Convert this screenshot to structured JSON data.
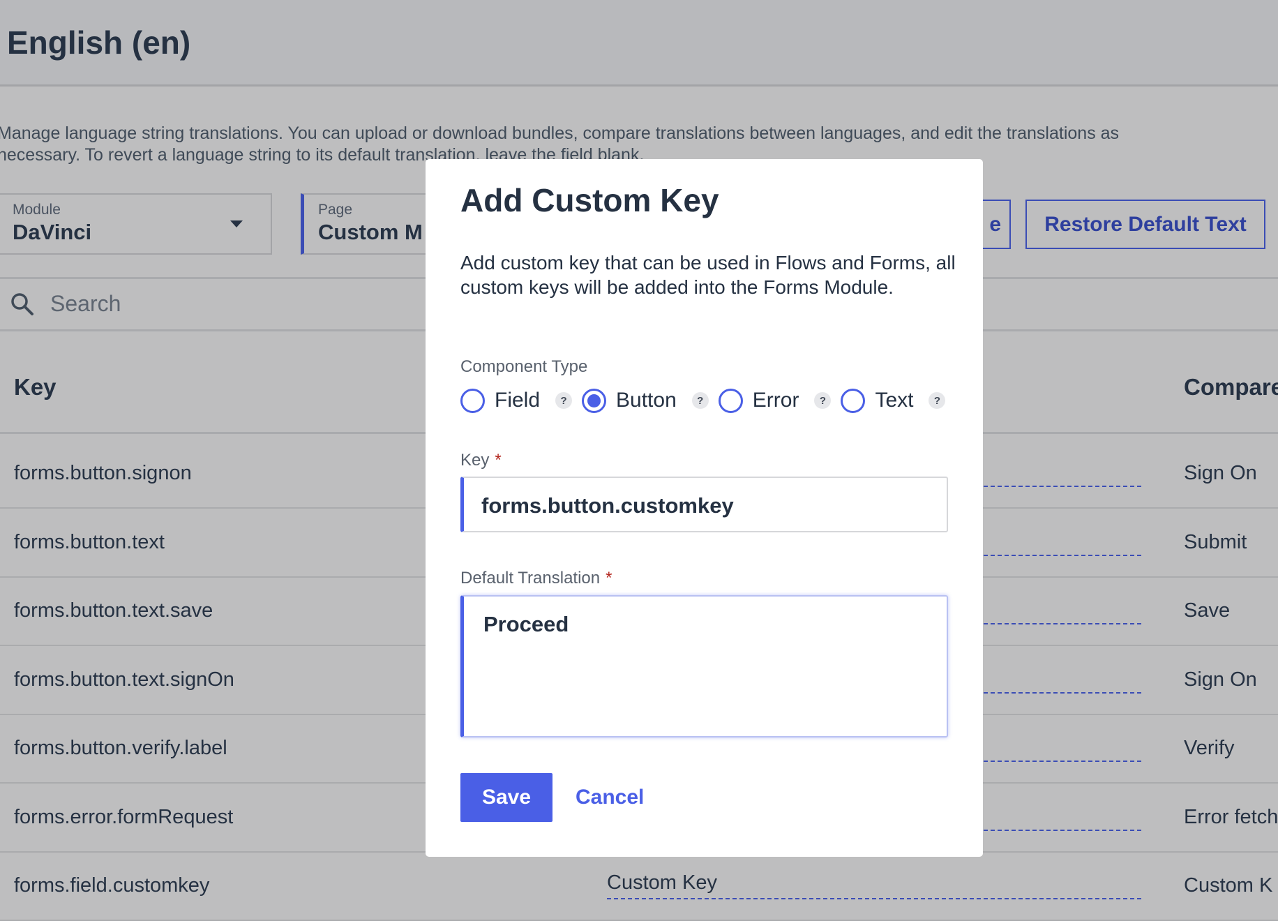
{
  "page": {
    "title": "English (en)",
    "description": "Manage language string translations. You can upload or download bundles, compare translations between languages, and edit the translations as necessary. To revert a language string to its default translation, leave the field blank.",
    "filters": {
      "module": {
        "label": "Module",
        "value": "DaVinci"
      },
      "page": {
        "label": "Page",
        "value": "Custom M"
      }
    },
    "actions": {
      "partial_button": "e",
      "restore_default": "Restore Default Text"
    },
    "search": {
      "placeholder": "Search"
    },
    "table": {
      "columns": {
        "key": "Key",
        "compare": "Compare"
      },
      "rows": [
        {
          "key": "forms.button.signon",
          "translation": "",
          "compare": "Sign On"
        },
        {
          "key": "forms.button.text",
          "translation": "",
          "compare": "Submit"
        },
        {
          "key": "forms.button.text.save",
          "translation": "",
          "compare": "Save"
        },
        {
          "key": "forms.button.text.signOn",
          "translation": "",
          "compare": "Sign On"
        },
        {
          "key": "forms.button.verify.label",
          "translation": "",
          "compare": "Verify"
        },
        {
          "key": "forms.error.formRequest",
          "translation": "",
          "compare": "Error fetch"
        },
        {
          "key": "forms.field.customkey",
          "translation": "Custom Key",
          "compare": "Custom K"
        }
      ]
    }
  },
  "modal": {
    "title": "Add Custom Key",
    "description": "Add custom key that can be used in Flows and Forms, all custom keys will be added into the Forms Module.",
    "component_type": {
      "label": "Component Type",
      "options": [
        {
          "label": "Field",
          "selected": false
        },
        {
          "label": "Button",
          "selected": true
        },
        {
          "label": "Error",
          "selected": false
        },
        {
          "label": "Text",
          "selected": false
        }
      ],
      "help": "?"
    },
    "key": {
      "label": "Key",
      "required_mark": "*",
      "value": "forms.button.customkey"
    },
    "default_translation": {
      "label": "Default Translation",
      "required_mark": "*",
      "value": "Proceed"
    },
    "save_label": "Save",
    "cancel_label": "Cancel"
  },
  "colors": {
    "accent": "#4a5fe6",
    "overlay": "#bebebf",
    "text": "#253142"
  }
}
